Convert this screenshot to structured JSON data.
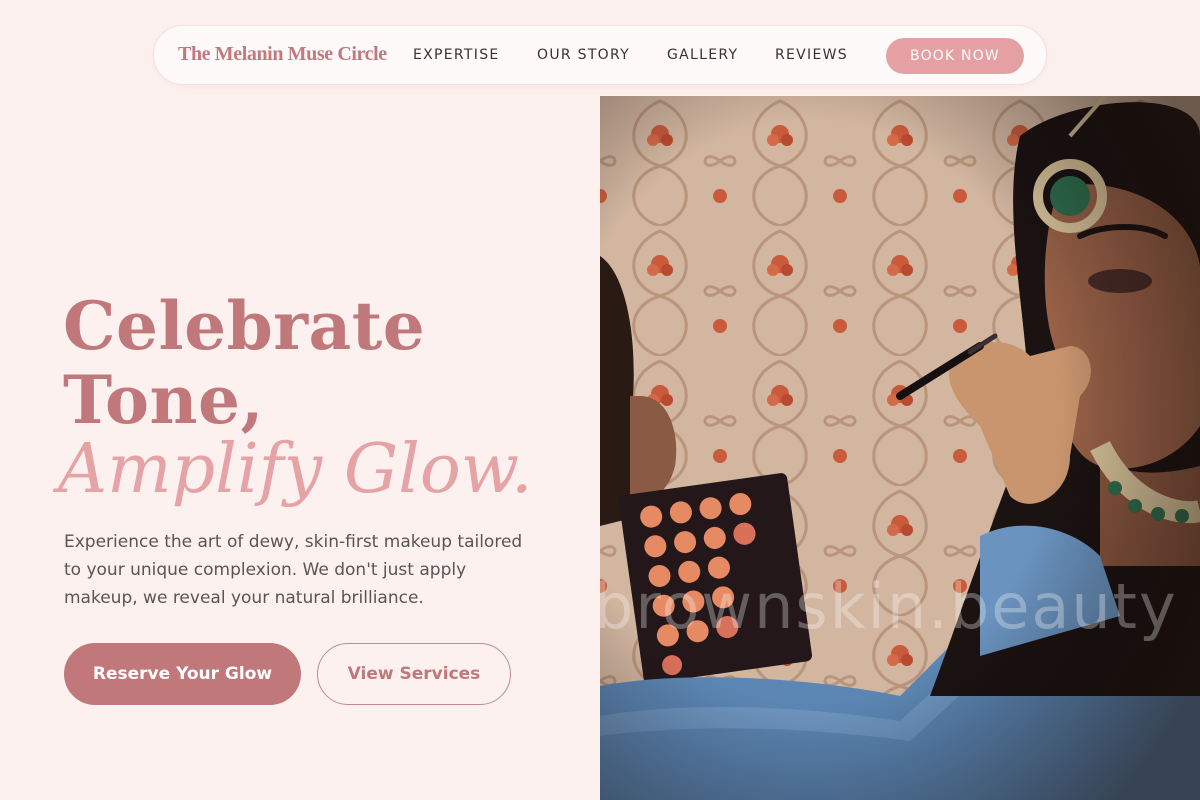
{
  "nav": {
    "brand": "The Melanin Muse Circle",
    "links": [
      "EXPERTISE",
      "OUR STORY",
      "GALLERY",
      "REVIEWS"
    ],
    "cta": "BOOK NOW"
  },
  "hero": {
    "heading_line1": "Celebrate",
    "heading_line2": "Tone,",
    "heading_line3": "Amplify Glow.",
    "description": "Experience the art of dewy, skin-first makeup tailored to your unique complexion. We don't just apply makeup, we reveal your natural brilliance.",
    "primary_cta": "Reserve Your Glow",
    "secondary_cta": "View Services",
    "image_watermark": "brownskin.beauty"
  },
  "colors": {
    "page_bg": "#fdf1f0",
    "brand_rose": "#c0787b",
    "accent_pink": "#e5a0a3",
    "text_dark": "#3a3232",
    "text_body": "#5a5454"
  }
}
